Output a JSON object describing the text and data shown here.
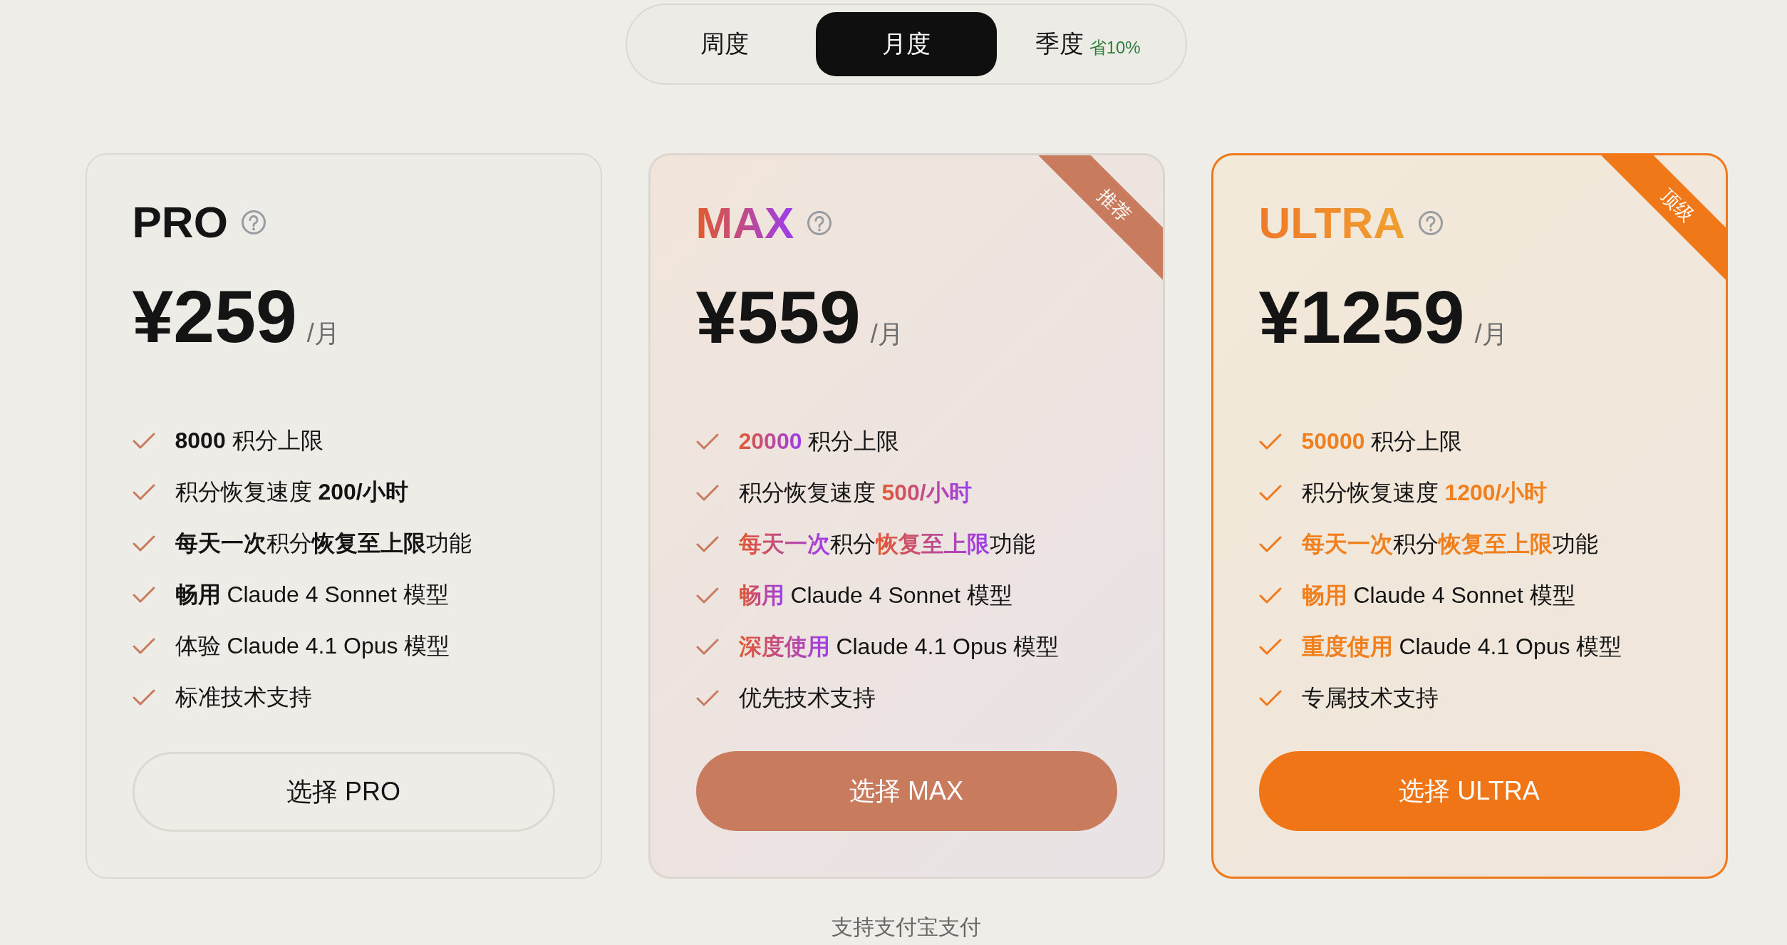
{
  "billing_tabs": [
    {
      "label": "周度",
      "selected": false
    },
    {
      "label": "月度",
      "selected": true
    },
    {
      "label": "季度",
      "badge": "省10%",
      "selected": false
    }
  ],
  "plans": [
    {
      "kind": "plain",
      "name": "PRO",
      "price": "¥259",
      "period": "/月",
      "features": [
        "**8000** 积分上限",
        "积分恢复速度 **200/小时**",
        "**每天一次**积分**恢复至上限**功能",
        "**畅用** Claude 4 Sonnet 模型",
        "体验 Claude 4.1 Opus 模型",
        "标准技术支持"
      ],
      "button": "选择 PRO"
    },
    {
      "kind": "gradient",
      "name": "MAX",
      "price": "¥559",
      "period": "/月",
      "ribbon": "推荐",
      "features": [
        "**20000** 积分上限",
        "积分恢复速度 **500/小时**",
        "**每天一次**积分**恢复至上限**功能",
        "**畅用** Claude 4 Sonnet 模型",
        "**深度使用** Claude 4.1 Opus 模型",
        "优先技术支持"
      ],
      "button": "选择 MAX"
    },
    {
      "kind": "orange",
      "name": "ULTRA",
      "price": "¥1259",
      "period": "/月",
      "ribbon": "顶级",
      "features": [
        "**50000** 积分上限",
        "积分恢复速度 **1200/小时**",
        "**每天一次**积分**恢复至上限**功能",
        "**畅用** Claude 4 Sonnet 模型",
        "**重度使用** Claude 4.1 Opus 模型",
        "专属技术支持"
      ],
      "button": "选择 ULTRA"
    }
  ],
  "footer_note": "支持支付宝支付"
}
